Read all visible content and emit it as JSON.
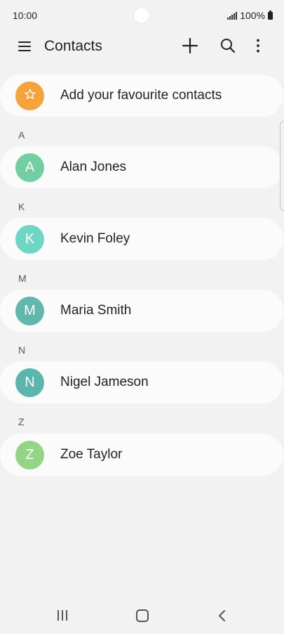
{
  "status_bar": {
    "time": "10:00",
    "battery_text": "100%",
    "icons": [
      "signal-icon",
      "battery-icon"
    ]
  },
  "app_bar": {
    "title": "Contacts",
    "icons": [
      "menu-icon",
      "add-icon",
      "search-icon",
      "more-options-icon"
    ]
  },
  "favourites": {
    "label": "Add your favourite contacts",
    "icon": "star-icon",
    "color": "#f5a33b"
  },
  "sections": [
    {
      "letter": "A",
      "contacts": [
        {
          "initial": "A",
          "name": "Alan Jones",
          "color": "#72cfa3"
        }
      ]
    },
    {
      "letter": "K",
      "contacts": [
        {
          "initial": "K",
          "name": "Kevin Foley",
          "color": "#6fd6c6"
        }
      ]
    },
    {
      "letter": "M",
      "contacts": [
        {
          "initial": "M",
          "name": "Maria Smith",
          "color": "#5fb8ab"
        }
      ]
    },
    {
      "letter": "N",
      "contacts": [
        {
          "initial": "N",
          "name": "Nigel Jameson",
          "color": "#5db6ad"
        }
      ]
    },
    {
      "letter": "Z",
      "contacts": [
        {
          "initial": "Z",
          "name": "Zoe Taylor",
          "color": "#94d585"
        }
      ]
    }
  ],
  "nav_bar": {
    "icons": [
      "recents-icon",
      "home-icon",
      "back-icon"
    ]
  }
}
